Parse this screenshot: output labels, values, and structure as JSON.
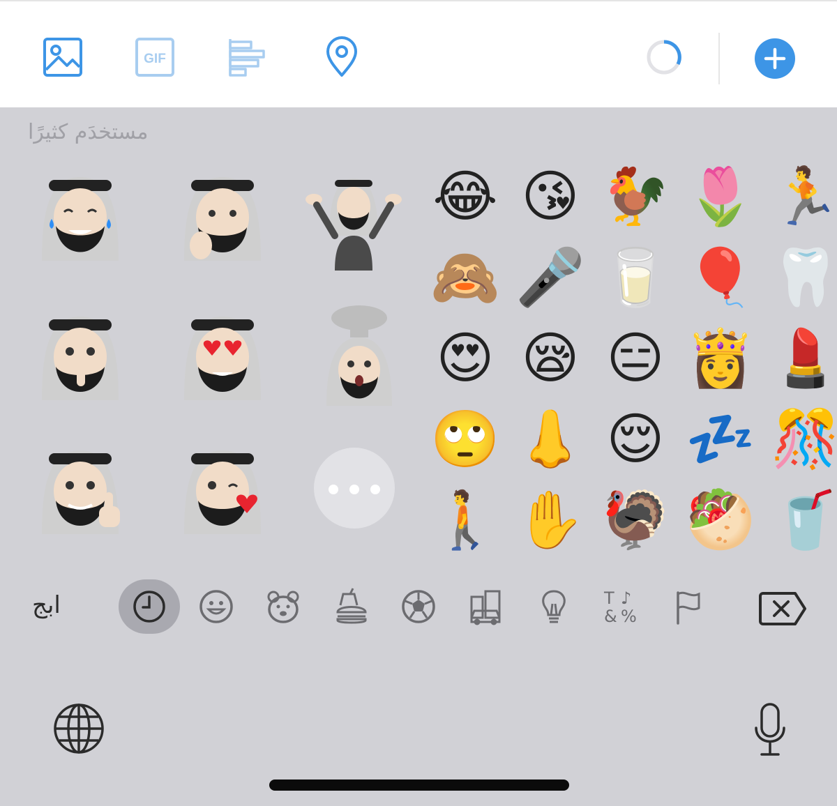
{
  "composer_toolbar": {
    "icons": [
      "image-icon",
      "gif-icon",
      "poll-icon",
      "location-icon"
    ],
    "gif_label": "GIF",
    "add_button_icon": "plus-icon",
    "accent_color": "#3d95e6"
  },
  "emoji_keyboard": {
    "section_title": "مستخدَم كثيرًا",
    "memoji_stickers": [
      "memoji-laughing-tears",
      "memoji-thinking",
      "memoji-shrug",
      "memoji-shush",
      "memoji-heart-eyes",
      "memoji-mind-blown",
      "memoji-thumbs-up",
      "memoji-wink-heart"
    ],
    "more_stickers_icon": "ellipsis-icon",
    "emojis": [
      "😂",
      "😘",
      "🐓",
      "🌷",
      "🏃",
      "🙈",
      "🎤",
      "🥛",
      "🎈",
      "🦷",
      "😍",
      "😪",
      "😑",
      "👸",
      "💄",
      "🙄",
      "👃",
      "😌",
      "💤",
      "🎊",
      "🚶",
      "✋",
      "🦃",
      "🥙",
      "🥤"
    ],
    "categories": {
      "abc_label": "ابج",
      "icons": [
        "recent-clock-icon",
        "smiley-icon",
        "animal-icon",
        "food-icon",
        "activity-ball-icon",
        "travel-icon",
        "lightbulb-icon",
        "symbols-icon",
        "flag-icon"
      ],
      "selected": "recent-clock-icon"
    },
    "delete_key_icon": "delete-key-icon",
    "globe_icon": "globe-icon",
    "mic_icon": "microphone-icon"
  }
}
